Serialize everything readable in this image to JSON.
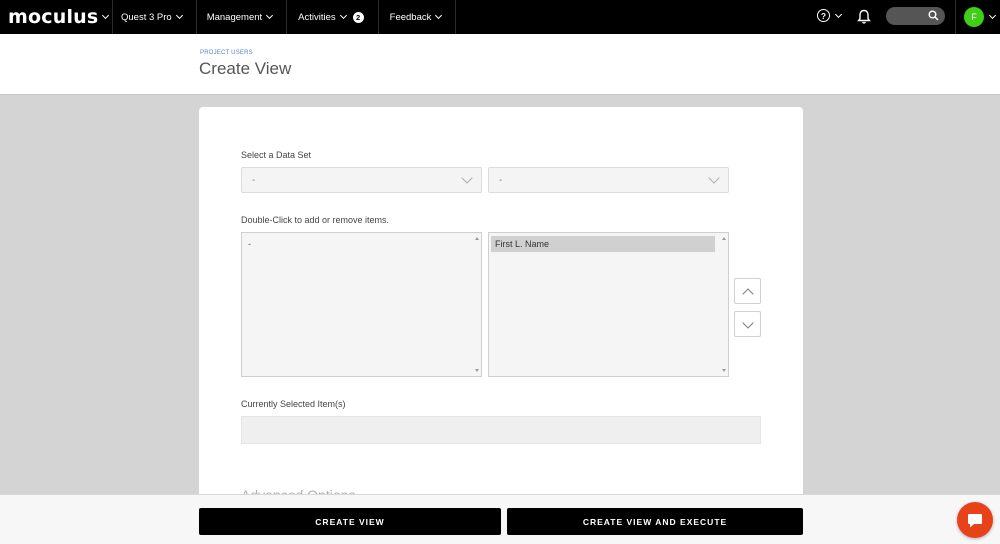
{
  "app": {
    "logo_text": "moculus"
  },
  "nav": {
    "items": [
      {
        "label": "Quest 3 Pro"
      },
      {
        "label": "Management"
      },
      {
        "label": "Activities",
        "badge": "2"
      },
      {
        "label": "Feedback"
      }
    ],
    "help_symbol": "?",
    "avatar_initial": "F"
  },
  "header": {
    "breadcrumb": "PROJECT USERS",
    "title": "Create View"
  },
  "form": {
    "dataset_label": "Select a Data Set",
    "dataset_select_1": "-",
    "dataset_select_2": "-",
    "items_label": "Double-Click to add or remove items.",
    "available_items": [
      "-"
    ],
    "chosen_items": [
      "First L. Name"
    ],
    "currently_selected_label": "Currently Selected Item(s)",
    "currently_selected_value": "",
    "advanced_options_label": "Advanced Options"
  },
  "footer": {
    "create_view_label": "CREATE VIEW",
    "create_execute_label": "CREATE VIEW AND EXECUTE"
  },
  "colors": {
    "nav_bg": "#000000",
    "avatar": "#3ecf16",
    "chat": "#e8421a",
    "breadcrumb": "#5a7fd0",
    "page_bg": "#d4d4d4"
  },
  "icons": [
    "chevron-down-icon",
    "help-icon",
    "bell-icon",
    "search-icon",
    "chevron-up-icon",
    "chat-icon"
  ]
}
